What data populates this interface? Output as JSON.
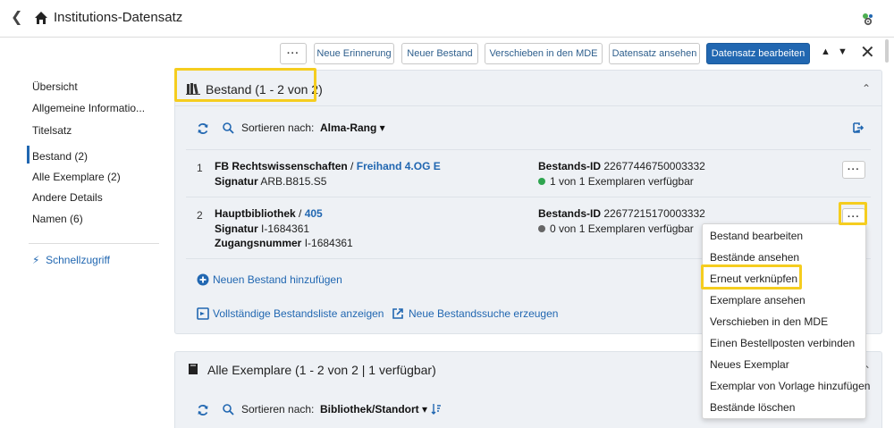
{
  "header": {
    "title": "Institutions-Datensatz"
  },
  "toolbar": {
    "more_label": "···",
    "buttons": [
      "Neue Erinnerung",
      "Neuer Bestand",
      "Verschieben in den MDE",
      "Datensatz ansehen",
      "Datensatz bearbeiten"
    ],
    "up_arrow": "▲",
    "down_arrow": "▼",
    "close": "✕"
  },
  "sidebar": {
    "items": [
      "Übersicht",
      "Allgemeine Informatio...",
      "Titelsatz",
      "Bestand (2)",
      "Alle Exemplare (2)",
      "Andere Details",
      "Namen (6)"
    ],
    "quick_access": "Schnellzugriff"
  },
  "holdings": {
    "title": "Bestand (1 - 2 von 2)",
    "sort_label": "Sortieren nach:",
    "sort_value": "Alma-Rang ▾",
    "rows": [
      {
        "num": "1",
        "library": "FB Rechtswissenschaften",
        "separator": " / ",
        "location": "Freihand 4.OG E",
        "call_label": "Signatur",
        "call_value": "ARB.B815.S5",
        "accession_label": "",
        "accession_value": "",
        "id_label": "Bestands-ID",
        "id_value": "22677446750003332",
        "availability": "1 von 1 Exemplaren verfügbar",
        "dot_color": "#2ea44f"
      },
      {
        "num": "2",
        "library": "Hauptbibliothek",
        "separator": " / ",
        "location": "405",
        "call_label": "Signatur",
        "call_value": "I-1684361",
        "accession_label": "Zugangsnummer",
        "accession_value": "I-1684361",
        "id_label": "Bestands-ID",
        "id_value": "22677215170003332",
        "availability": "0 von 1 Exemplaren verfügbar",
        "dot_color": "#666666"
      }
    ],
    "add_holding": "Neuen Bestand hinzufügen",
    "full_list": "Vollständige Bestandsliste anzeigen",
    "new_search": "Neue Bestandssuche erzeugen",
    "row_more": "···"
  },
  "dropdown": {
    "items": [
      "Bestand bearbeiten",
      "Bestände ansehen",
      "Erneut verknüpfen",
      "Exemplare ansehen",
      "Verschieben in den MDE",
      "Einen Bestellposten verbinden",
      "Neues Exemplar",
      "Exemplar von Vorlage hinzufügen",
      "Bestände löschen"
    ]
  },
  "items_panel": {
    "title": "Alle Exemplare (1 - 2 von 2  |  1 verfügbar)",
    "sort_label": "Sortieren nach:",
    "sort_value": "Bibliothek/Standort ▾"
  },
  "colors": {
    "accent": "#2167b1",
    "highlight": "#f5cd1f",
    "panel_bg": "#eef1f5",
    "available": "#2ea44f"
  },
  "icons": {
    "back": "chevron-left-icon",
    "home": "home-icon",
    "settings": "gear-icon",
    "holdings": "books-icon",
    "refresh": "refresh-icon",
    "search": "search-icon",
    "export": "export-icon",
    "add": "plus-circle-icon",
    "list": "list-icon",
    "new_search": "external-icon",
    "items": "bookmark-icon",
    "sort_direction": "sort-desc-icon",
    "quick_access": "bolt-icon"
  }
}
